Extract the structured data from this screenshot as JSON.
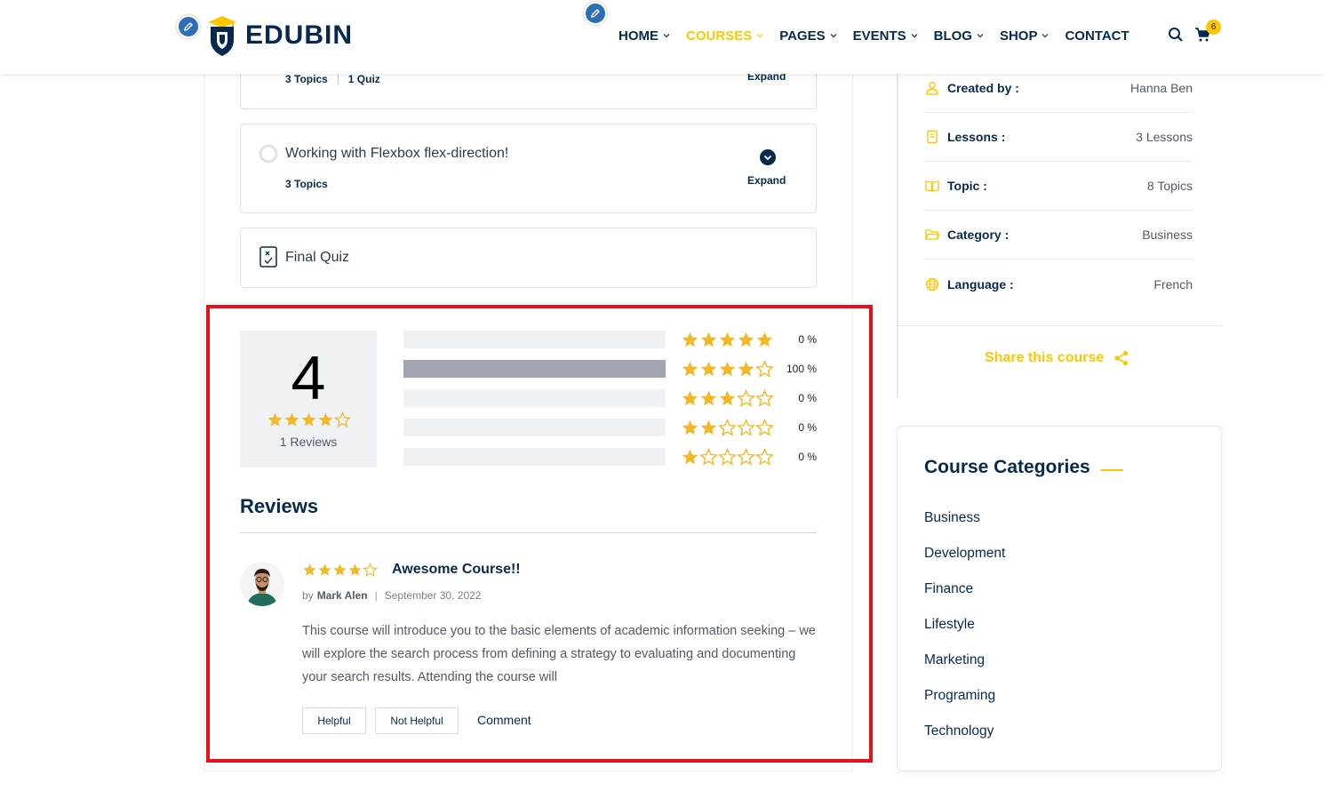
{
  "header": {
    "logo_text": "EDUBIN",
    "nav": [
      {
        "label": "HOME",
        "has_dropdown": true,
        "active": false
      },
      {
        "label": "COURSES",
        "has_dropdown": true,
        "active": true
      },
      {
        "label": "PAGES",
        "has_dropdown": true,
        "active": false
      },
      {
        "label": "EVENTS",
        "has_dropdown": true,
        "active": false
      },
      {
        "label": "BLOG",
        "has_dropdown": true,
        "active": false
      },
      {
        "label": "SHOP",
        "has_dropdown": true,
        "active": false
      },
      {
        "label": "CONTACT",
        "has_dropdown": false,
        "active": false
      }
    ],
    "cart_count": "6",
    "icons": [
      "edit-icon",
      "search-icon",
      "cart-icon"
    ]
  },
  "curriculum": {
    "prev_lesson": {
      "topics": "3 Topics",
      "quiz": "1 Quiz",
      "expand_label": "Expand"
    },
    "lesson": {
      "title": "Working with Flexbox flex-direction!",
      "topics": "3 Topics",
      "expand_label": "Expand"
    },
    "final_quiz": {
      "title": "Final Quiz"
    }
  },
  "rating_summary": {
    "average": "4",
    "average_stars": 4,
    "reviews_count": "1 Reviews",
    "breakdown": [
      {
        "stars": 5,
        "percent_label": "0 %",
        "percent": 0
      },
      {
        "stars": 4,
        "percent_label": "100 %",
        "percent": 100
      },
      {
        "stars": 3,
        "percent_label": "0 %",
        "percent": 0
      },
      {
        "stars": 2,
        "percent_label": "0 %",
        "percent": 0
      },
      {
        "stars": 1,
        "percent_label": "0 %",
        "percent": 0
      }
    ]
  },
  "reviews": {
    "heading": "Reviews",
    "items": [
      {
        "stars": 4,
        "title": "Awesome Course!!",
        "by_label": "by",
        "author": "Mark Alen",
        "date": "September 30, 2022",
        "body": "This course will introduce you to the basic elements of academic information seeking – we will explore the search process from defining a strategy to evaluating and documenting your search results. Attending the course will",
        "helpful_label": "Helpful",
        "not_helpful_label": "Not Helpful",
        "comment_label": "Comment"
      }
    ]
  },
  "course_info": {
    "rows": [
      {
        "icon": "user-icon",
        "label": "Created by :",
        "value": "Hanna Ben"
      },
      {
        "icon": "book-icon",
        "label": "Lessons :",
        "value": "3 Lessons"
      },
      {
        "icon": "open-book-icon",
        "label": "Topic :",
        "value": "8 Topics"
      },
      {
        "icon": "folder-icon",
        "label": "Category :",
        "value": "Business"
      },
      {
        "icon": "globe-icon",
        "label": "Language :",
        "value": "French"
      }
    ],
    "share_label": "Share this course"
  },
  "categories": {
    "heading": "Course Categories",
    "items": [
      "Business",
      "Development",
      "Finance",
      "Lifestyle",
      "Marketing",
      "Programing",
      "Technology"
    ]
  },
  "colors": {
    "accent": "#ffc600",
    "primary": "#07294d",
    "highlight_border": "#e8101d",
    "star": "#f2b827"
  }
}
